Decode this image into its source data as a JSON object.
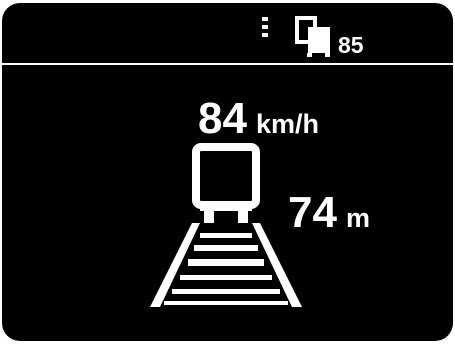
{
  "header": {
    "menu_icon": "menu-dots-icon",
    "vehicle_icon": "linked-vehicles-icon",
    "vehicle_count": "85"
  },
  "main": {
    "speed_value": "84",
    "speed_unit": "km/h",
    "train_icon": "train-front-icon",
    "track_icon": "railway-track-icon",
    "distance_value": "74",
    "distance_unit": "m"
  },
  "colors": {
    "background": "#000000",
    "foreground": "#ffffff",
    "frame": "#ffffff"
  }
}
